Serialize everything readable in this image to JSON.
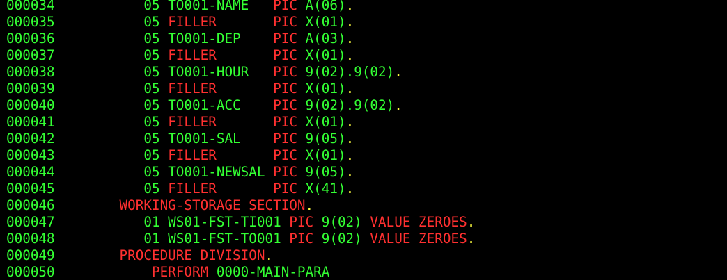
{
  "colors": {
    "background": "#000000",
    "green": "#33ff33",
    "red": "#ff3030",
    "yellow": "#ffff40"
  },
  "lines": [
    {
      "seq": "000034",
      "segments": [
        {
          "t": "           05 ",
          "c": "g"
        },
        {
          "t": "TO001-NAME   ",
          "c": "g"
        },
        {
          "t": "PIC ",
          "c": "r"
        },
        {
          "t": "A(06)",
          "c": "g"
        },
        {
          "t": ".",
          "c": "y"
        }
      ]
    },
    {
      "seq": "000035",
      "segments": [
        {
          "t": "           05 ",
          "c": "g"
        },
        {
          "t": "FILLER       ",
          "c": "r"
        },
        {
          "t": "PIC ",
          "c": "r"
        },
        {
          "t": "X(01)",
          "c": "g"
        },
        {
          "t": ".",
          "c": "y"
        }
      ]
    },
    {
      "seq": "000036",
      "segments": [
        {
          "t": "           05 ",
          "c": "g"
        },
        {
          "t": "TO001-DEP    ",
          "c": "g"
        },
        {
          "t": "PIC ",
          "c": "r"
        },
        {
          "t": "A(03)",
          "c": "g"
        },
        {
          "t": ".",
          "c": "y"
        }
      ]
    },
    {
      "seq": "000037",
      "segments": [
        {
          "t": "           05 ",
          "c": "g"
        },
        {
          "t": "FILLER       ",
          "c": "r"
        },
        {
          "t": "PIC ",
          "c": "r"
        },
        {
          "t": "X(01)",
          "c": "g"
        },
        {
          "t": ".",
          "c": "y"
        }
      ]
    },
    {
      "seq": "000038",
      "segments": [
        {
          "t": "           05 ",
          "c": "g"
        },
        {
          "t": "TO001-HOUR   ",
          "c": "g"
        },
        {
          "t": "PIC ",
          "c": "r"
        },
        {
          "t": "9(02).9(02)",
          "c": "g"
        },
        {
          "t": ".",
          "c": "y"
        }
      ]
    },
    {
      "seq": "000039",
      "segments": [
        {
          "t": "           05 ",
          "c": "g"
        },
        {
          "t": "FILLER       ",
          "c": "r"
        },
        {
          "t": "PIC ",
          "c": "r"
        },
        {
          "t": "X(01)",
          "c": "g"
        },
        {
          "t": ".",
          "c": "y"
        }
      ]
    },
    {
      "seq": "000040",
      "segments": [
        {
          "t": "           05 ",
          "c": "g"
        },
        {
          "t": "TO001-ACC    ",
          "c": "g"
        },
        {
          "t": "PIC ",
          "c": "r"
        },
        {
          "t": "9(02).9(02)",
          "c": "g"
        },
        {
          "t": ".",
          "c": "y"
        }
      ]
    },
    {
      "seq": "000041",
      "segments": [
        {
          "t": "           05 ",
          "c": "g"
        },
        {
          "t": "FILLER       ",
          "c": "r"
        },
        {
          "t": "PIC ",
          "c": "r"
        },
        {
          "t": "X(01)",
          "c": "g"
        },
        {
          "t": ".",
          "c": "y"
        }
      ]
    },
    {
      "seq": "000042",
      "segments": [
        {
          "t": "           05 ",
          "c": "g"
        },
        {
          "t": "TO001-SAL    ",
          "c": "g"
        },
        {
          "t": "PIC ",
          "c": "r"
        },
        {
          "t": "9(05)",
          "c": "g"
        },
        {
          "t": ".",
          "c": "y"
        }
      ]
    },
    {
      "seq": "000043",
      "segments": [
        {
          "t": "           05 ",
          "c": "g"
        },
        {
          "t": "FILLER       ",
          "c": "r"
        },
        {
          "t": "PIC ",
          "c": "r"
        },
        {
          "t": "X(01)",
          "c": "g"
        },
        {
          "t": ".",
          "c": "y"
        }
      ]
    },
    {
      "seq": "000044",
      "segments": [
        {
          "t": "           05 ",
          "c": "g"
        },
        {
          "t": "TO001-NEWSAL ",
          "c": "g"
        },
        {
          "t": "PIC ",
          "c": "r"
        },
        {
          "t": "9(05)",
          "c": "g"
        },
        {
          "t": ".",
          "c": "y"
        }
      ]
    },
    {
      "seq": "000045",
      "segments": [
        {
          "t": "           05 ",
          "c": "g"
        },
        {
          "t": "FILLER       ",
          "c": "r"
        },
        {
          "t": "PIC ",
          "c": "r"
        },
        {
          "t": "X(41)",
          "c": "g"
        },
        {
          "t": ".",
          "c": "y"
        }
      ]
    },
    {
      "seq": "000046",
      "segments": [
        {
          "t": "        WORKING-STORAGE SECTION",
          "c": "r"
        },
        {
          "t": ".",
          "c": "y"
        }
      ]
    },
    {
      "seq": "000047",
      "segments": [
        {
          "t": "           01 WS01-FST-TI001 ",
          "c": "g"
        },
        {
          "t": "PIC ",
          "c": "r"
        },
        {
          "t": "9(02) ",
          "c": "g"
        },
        {
          "t": "VALUE ZEROES",
          "c": "r"
        },
        {
          "t": ".",
          "c": "y"
        }
      ]
    },
    {
      "seq": "000048",
      "segments": [
        {
          "t": "           01 WS01-FST-TO001 ",
          "c": "g"
        },
        {
          "t": "PIC ",
          "c": "r"
        },
        {
          "t": "9(02) ",
          "c": "g"
        },
        {
          "t": "VALUE ZEROES",
          "c": "r"
        },
        {
          "t": ".",
          "c": "y"
        }
      ]
    },
    {
      "seq": "000049",
      "segments": [
        {
          "t": "        PROCEDURE DIVISION",
          "c": "r"
        },
        {
          "t": ".",
          "c": "y"
        }
      ]
    },
    {
      "seq": "000050",
      "segments": [
        {
          "t": "            PERFORM ",
          "c": "r"
        },
        {
          "t": "0000-MAIN-PARA",
          "c": "g"
        }
      ]
    }
  ]
}
